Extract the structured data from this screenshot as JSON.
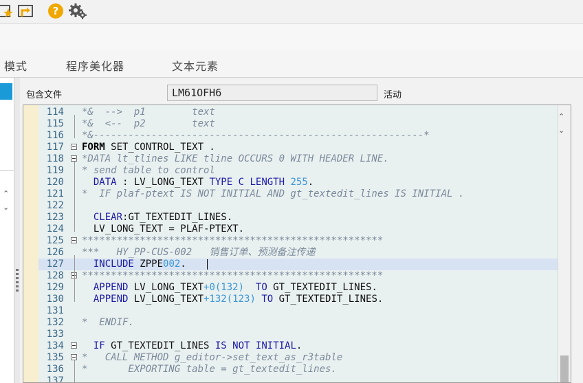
{
  "toolbar": {
    "icons": [
      "bookmark-star-icon",
      "link-arrow-icon",
      "help-icon",
      "settings-icon"
    ]
  },
  "menu": {
    "items": [
      "模式",
      "程序美化器",
      "文本元素"
    ]
  },
  "include_field": {
    "label": "包含文件",
    "value": "LM61OFH6",
    "status": "活动"
  },
  "editor": {
    "lines": [
      {
        "num": "114",
        "text": "*&  -->  p1        text"
      },
      {
        "num": "115",
        "text": "*&  <--  p2        text"
      },
      {
        "num": "116",
        "text": "*&---------------------------------------------------------*"
      },
      {
        "num": "117",
        "text": "FORM SET_CONTROL_TEXT ."
      },
      {
        "num": "118",
        "text": "*DATA lt_tlines LIKE tline OCCURS 0 WITH HEADER LINE."
      },
      {
        "num": "119",
        "text": "* send table to control"
      },
      {
        "num": "120",
        "text": "  DATA : LV_LONG_TEXT TYPE C LENGTH 255."
      },
      {
        "num": "121",
        "text": "*  IF plaf-ptext IS NOT INITIAL AND gt_textedit_lines IS INITIAL ."
      },
      {
        "num": "122",
        "text": ""
      },
      {
        "num": "123",
        "text": "  CLEAR:GT_TEXTEDIT_LINES."
      },
      {
        "num": "124",
        "text": "  LV_LONG_TEXT = PLAF-PTEXT."
      },
      {
        "num": "125",
        "text": "****************************************************"
      },
      {
        "num": "126",
        "text": "***   HY_PP-CUS-002   销售订单、预测备注传递"
      },
      {
        "num": "127",
        "text": "  INCLUDE ZPPE002."
      },
      {
        "num": "128",
        "text": "****************************************************"
      },
      {
        "num": "129",
        "text": "  APPEND LV_LONG_TEXT+0(132)  TO GT_TEXTEDIT_LINES."
      },
      {
        "num": "130",
        "text": "  APPEND LV_LONG_TEXT+132(123) TO GT_TEXTEDIT_LINES."
      },
      {
        "num": "131",
        "text": ""
      },
      {
        "num": "132",
        "text": "*  ENDIF."
      },
      {
        "num": "133",
        "text": ""
      },
      {
        "num": "134",
        "text": "  IF GT_TEXTEDIT_LINES IS NOT INITIAL."
      },
      {
        "num": "135",
        "text": "*   CALL METHOD g_editor->set_text_as_r3table"
      },
      {
        "num": "136",
        "text": "*       EXPORTING table = gt_textedit_lines."
      },
      {
        "num": "137",
        "text": ""
      }
    ]
  }
}
